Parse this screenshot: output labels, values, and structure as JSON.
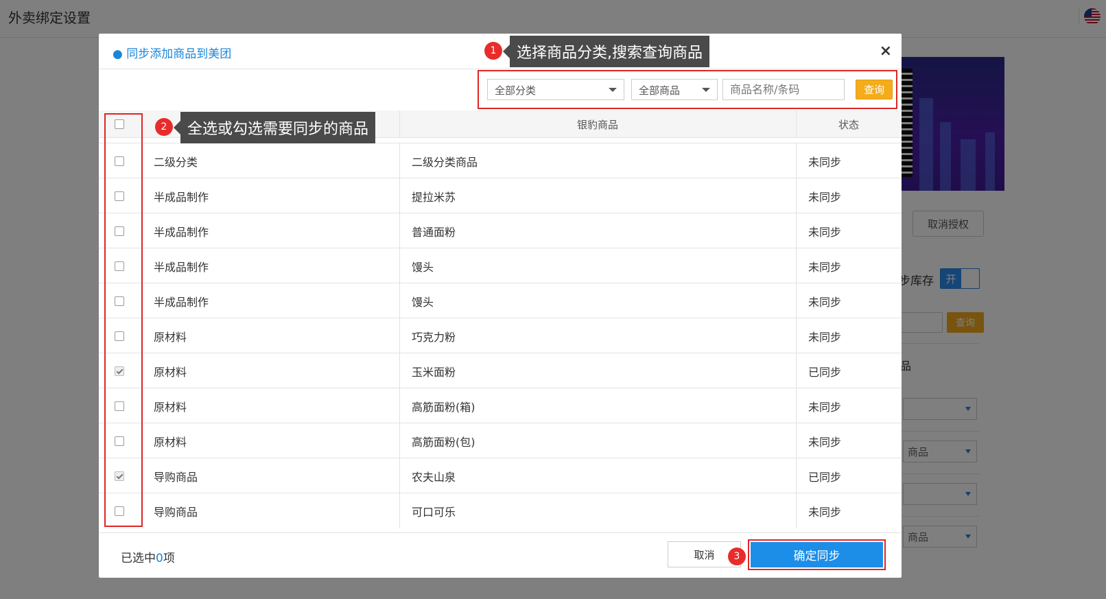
{
  "page": {
    "title": "外卖绑定设置",
    "bg_cancel_auth": "取消授权",
    "bg_stock_label": "步库存",
    "bg_toggle_on": "开",
    "bg_query": "查询",
    "bg_section": "品",
    "bg_select_labels": [
      "",
      "商品",
      "",
      "商品"
    ]
  },
  "modal": {
    "title": "● 同步添加商品到美团",
    "close": "×",
    "filters": {
      "category": "全部分类",
      "goods": "全部商品",
      "search_placeholder": "商品名称/条码",
      "query": "查询"
    },
    "table": {
      "headers": [
        "",
        "银豹商品",
        "状态"
      ],
      "rows": [
        {
          "category": "二级分类",
          "product": "二级分类商品",
          "status": "未同步",
          "checked": false
        },
        {
          "category": "半成品制作",
          "product": "提拉米苏",
          "status": "未同步",
          "checked": false
        },
        {
          "category": "半成品制作",
          "product": "普通面粉",
          "status": "未同步",
          "checked": false
        },
        {
          "category": "半成品制作",
          "product": "馒头",
          "status": "未同步",
          "checked": false
        },
        {
          "category": "半成品制作",
          "product": "馒头",
          "status": "未同步",
          "checked": false
        },
        {
          "category": "原材料",
          "product": "巧克力粉",
          "status": "未同步",
          "checked": false
        },
        {
          "category": "原材料",
          "product": "玉米面粉",
          "status": "已同步",
          "checked": true
        },
        {
          "category": "原材料",
          "product": "高筋面粉(箱)",
          "status": "未同步",
          "checked": false
        },
        {
          "category": "原材料",
          "product": "高筋面粉(包)",
          "status": "未同步",
          "checked": false
        },
        {
          "category": "导购商品",
          "product": "农夫山泉",
          "status": "已同步",
          "checked": true
        },
        {
          "category": "导购商品",
          "product": "可口可乐",
          "status": "未同步",
          "checked": false
        }
      ]
    },
    "footer": {
      "selected_prefix": "已选中",
      "selected_count": "0",
      "selected_suffix": "项",
      "cancel": "取消",
      "confirm": "确定同步"
    }
  },
  "tips": {
    "tip1": {
      "num": "1",
      "text": "选择商品分类,搜索查询商品"
    },
    "tip2": {
      "num": "2",
      "text": "全选或勾选需要同步的商品"
    },
    "tip3": {
      "num": "3"
    }
  },
  "colors": {
    "accent": "#1c8ee8",
    "query": "#f4ac1b",
    "highlight": "#e02424",
    "synced_check": "#777777"
  }
}
